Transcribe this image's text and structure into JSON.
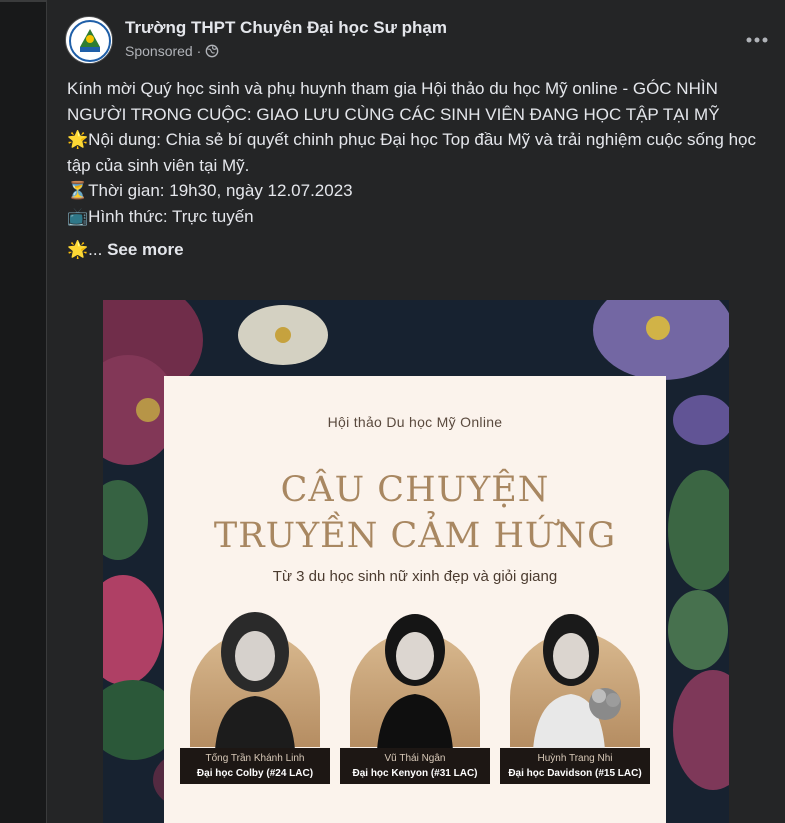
{
  "post": {
    "page_name": "Trường THPT Chuyên Đại học Sư phạm",
    "sponsored": "Sponsored ·",
    "lines": [
      "Kính mời Quý học sinh và phụ huynh tham gia Hội thảo du học Mỹ online - GÓC NHÌN NGƯỜI TRONG CUỘC: GIAO LƯU CÙNG CÁC SINH VIÊN ĐANG HỌC TẬP TẠI MỸ",
      "🌟Nội dung: Chia sẻ bí quyết chinh phục Đại học Top đầu Mỹ và trải nghiệm cuộc sống học tập của sinh viên tại Mỹ.",
      "⏳Thời gian: 19h30, ngày 12.07.2023",
      "📺Hình thức: Trực tuyến"
    ],
    "see_more_prefix": "🌟...",
    "see_more": "See more"
  },
  "poster": {
    "subtitle": "Hội thảo Du học Mỹ Online",
    "title_line1": "CÂU CHUYỆN",
    "title_line2": "TRUYỀN CẢM HỨNG",
    "tagline": "Từ 3 du học sinh nữ xinh đẹp và giỏi giang",
    "speakers": [
      {
        "name": "Tống Trần Khánh Linh",
        "school": "Đại học Colby (#24 LAC)"
      },
      {
        "name": "Vũ Thái Ngân",
        "school": "Đại học Kenyon (#31 LAC)"
      },
      {
        "name": "Huỳnh Trang Nhi",
        "school": "Đại học Davidson (#15 LAC)"
      }
    ]
  },
  "icons": {
    "globe": "globe-icon",
    "more": "more-options-icon"
  },
  "colors": {
    "background": "#18191a",
    "card": "#242526",
    "text_primary": "#e4e6eb",
    "text_secondary": "#b0b3b8",
    "poster_gold": "#a88761"
  }
}
